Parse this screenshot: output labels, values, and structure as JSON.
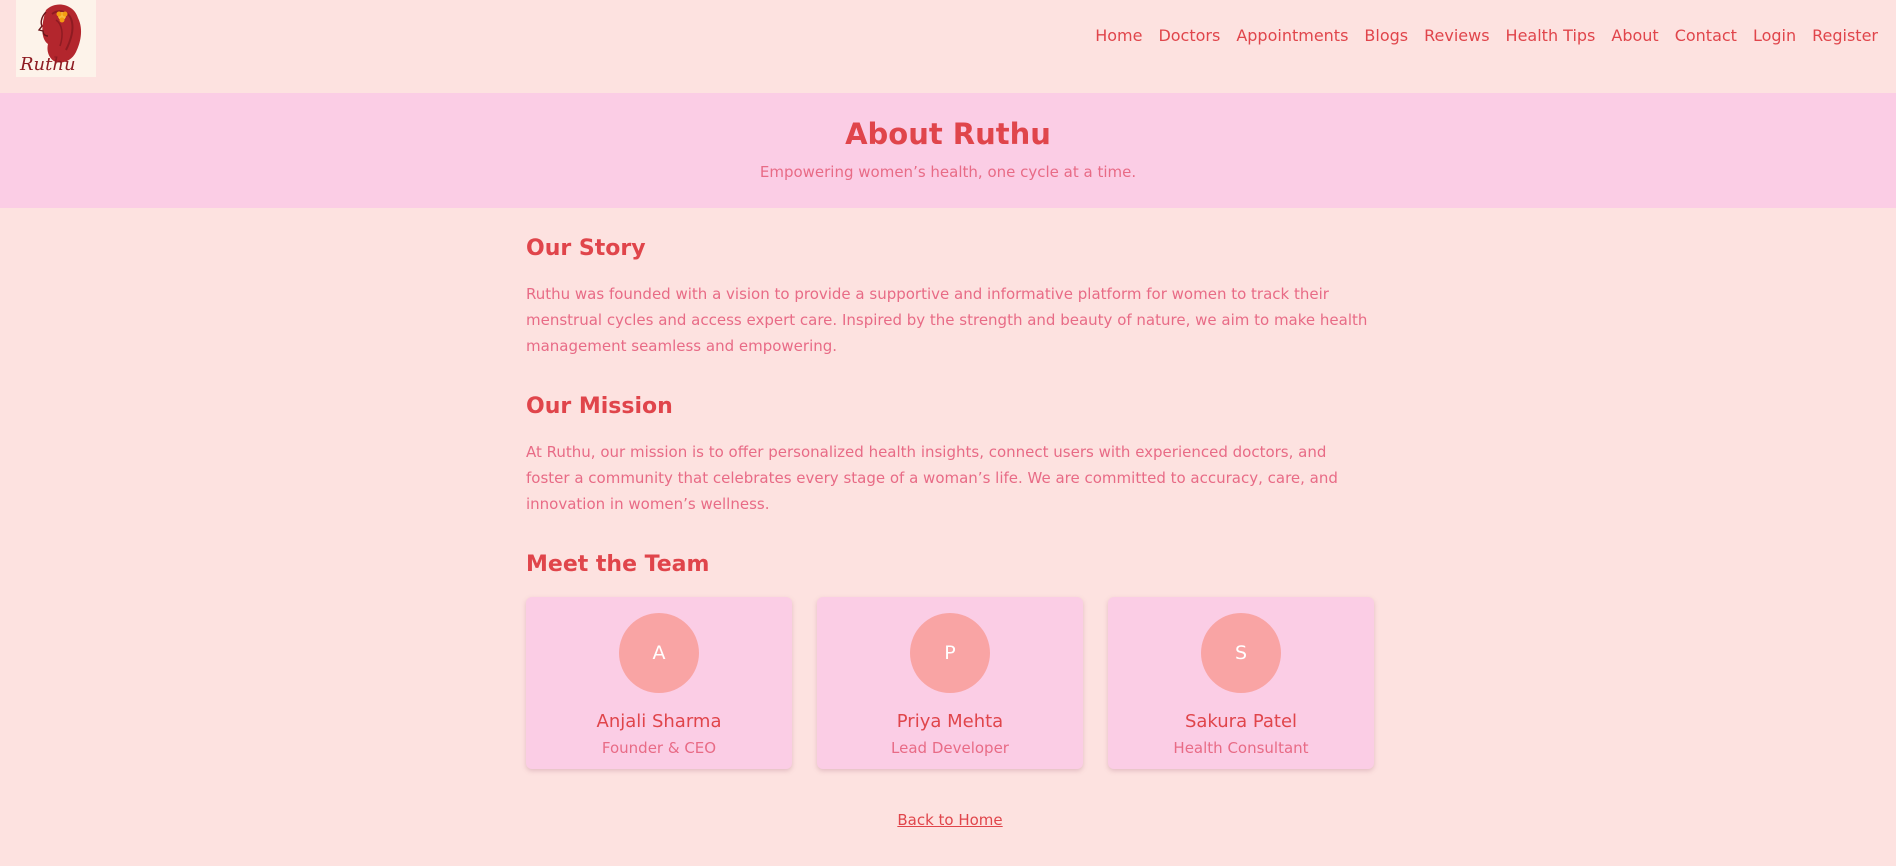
{
  "brand": {
    "logo_text": "Ruthu",
    "colors": {
      "page_background": "#fde2e0",
      "hero_background": "#fbcde5",
      "logo_background": "#fdf3ea",
      "primary": "#e0454b",
      "secondary_text": "#e86b86",
      "avatar": "#f9a4a4"
    }
  },
  "nav": {
    "items": [
      {
        "label": "Home"
      },
      {
        "label": "Doctors"
      },
      {
        "label": "Appointments"
      },
      {
        "label": "Blogs"
      },
      {
        "label": "Reviews"
      },
      {
        "label": "Health Tips"
      },
      {
        "label": "About"
      },
      {
        "label": "Contact"
      },
      {
        "label": "Login"
      },
      {
        "label": "Register"
      }
    ]
  },
  "hero": {
    "title": "About Ruthu",
    "subtitle": "Empowering women’s health, one cycle at a time."
  },
  "story": {
    "title": "Our Story",
    "text": "Ruthu was founded with a vision to provide a supportive and informative platform for women to track their menstrual cycles and access expert care. Inspired by the strength and beauty of nature, we aim to make health management seamless and empowering."
  },
  "mission": {
    "title": "Our Mission",
    "text": "At Ruthu, our mission is to offer personalized health insights, connect users with experienced doctors, and foster a community that celebrates every stage of a woman’s life. We are committed to accuracy, care, and innovation in women’s wellness."
  },
  "team": {
    "title": "Meet the Team",
    "members": [
      {
        "initial": "A",
        "name": "Anjali Sharma",
        "role": "Founder & CEO"
      },
      {
        "initial": "P",
        "name": "Priya Mehta",
        "role": "Lead Developer"
      },
      {
        "initial": "S",
        "name": "Sakura Patel",
        "role": "Health Consultant"
      }
    ]
  },
  "footer": {
    "back_link": "Back to Home"
  }
}
